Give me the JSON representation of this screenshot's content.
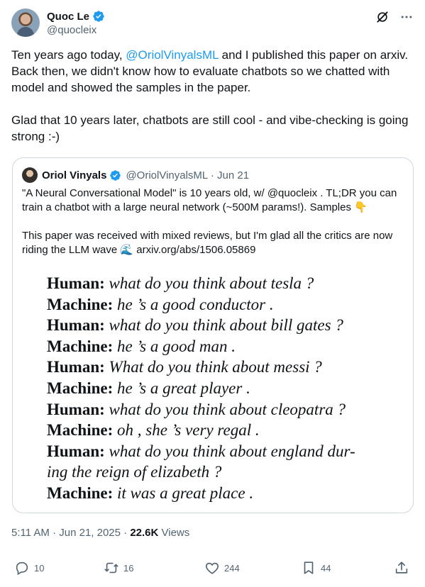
{
  "author": {
    "name": "Quoc Le",
    "handle": "@quocleix"
  },
  "tweet": {
    "paragraph1": {
      "before": "Ten years ago today, ",
      "mention": "@OriolVinyalsML",
      "after": " and I published this paper on arxiv. Back then, we didn't know how to evaluate chatbots so we chatted with model and showed the samples in the paper."
    },
    "paragraph2": "Glad that 10 years later, chatbots are still cool - and vibe-checking is going strong :-)"
  },
  "quote": {
    "name": "Oriol Vinyals",
    "meta": "@OriolVinyalsML · Jun 21",
    "text1": "\"A Neural Conversational Model\" is 10 years old, w/ @quocleix . TL;DR you can train a chatbot with a large neural network (~500M params!). Samples 👇",
    "text2": "This paper was received with mixed reviews, but I'm glad all the critics are now riding the LLM wave 🌊 arxiv.org/abs/1506.05869",
    "lines": [
      {
        "speaker": "Human:",
        "text": "what do you think about tesla ?"
      },
      {
        "speaker": "Machine:",
        "text": "he ’s a good conductor ."
      },
      {
        "speaker": "Human:",
        "text": "what do you think about bill gates ?"
      },
      {
        "speaker": "Machine:",
        "text": "he ’s a good man ."
      },
      {
        "speaker": "Human:",
        "text": "What do you think about messi ?"
      },
      {
        "speaker": "Machine:",
        "text": "he ’s a great player ."
      },
      {
        "speaker": "Human:",
        "text": "what do you think about cleopatra ?"
      },
      {
        "speaker": "Machine:",
        "text": "oh , she ’s very regal ."
      },
      {
        "speaker": "Human:",
        "text": "what do you think about england dur-"
      },
      {
        "speaker": "",
        "text": "ing the reign of elizabeth ?"
      },
      {
        "speaker": "Machine:",
        "text": "it was a great place ."
      }
    ]
  },
  "timestamp": {
    "time": "5:11 AM · Jun 21, 2025 · ",
    "views": "22.6K",
    "views_label": " Views"
  },
  "actions": {
    "replies": "10",
    "reposts": "16",
    "likes": "244",
    "bookmarks": "44"
  },
  "colors": {
    "accent": "#1d9bf0",
    "secondary_text": "#536471",
    "border": "#cfd9de"
  }
}
